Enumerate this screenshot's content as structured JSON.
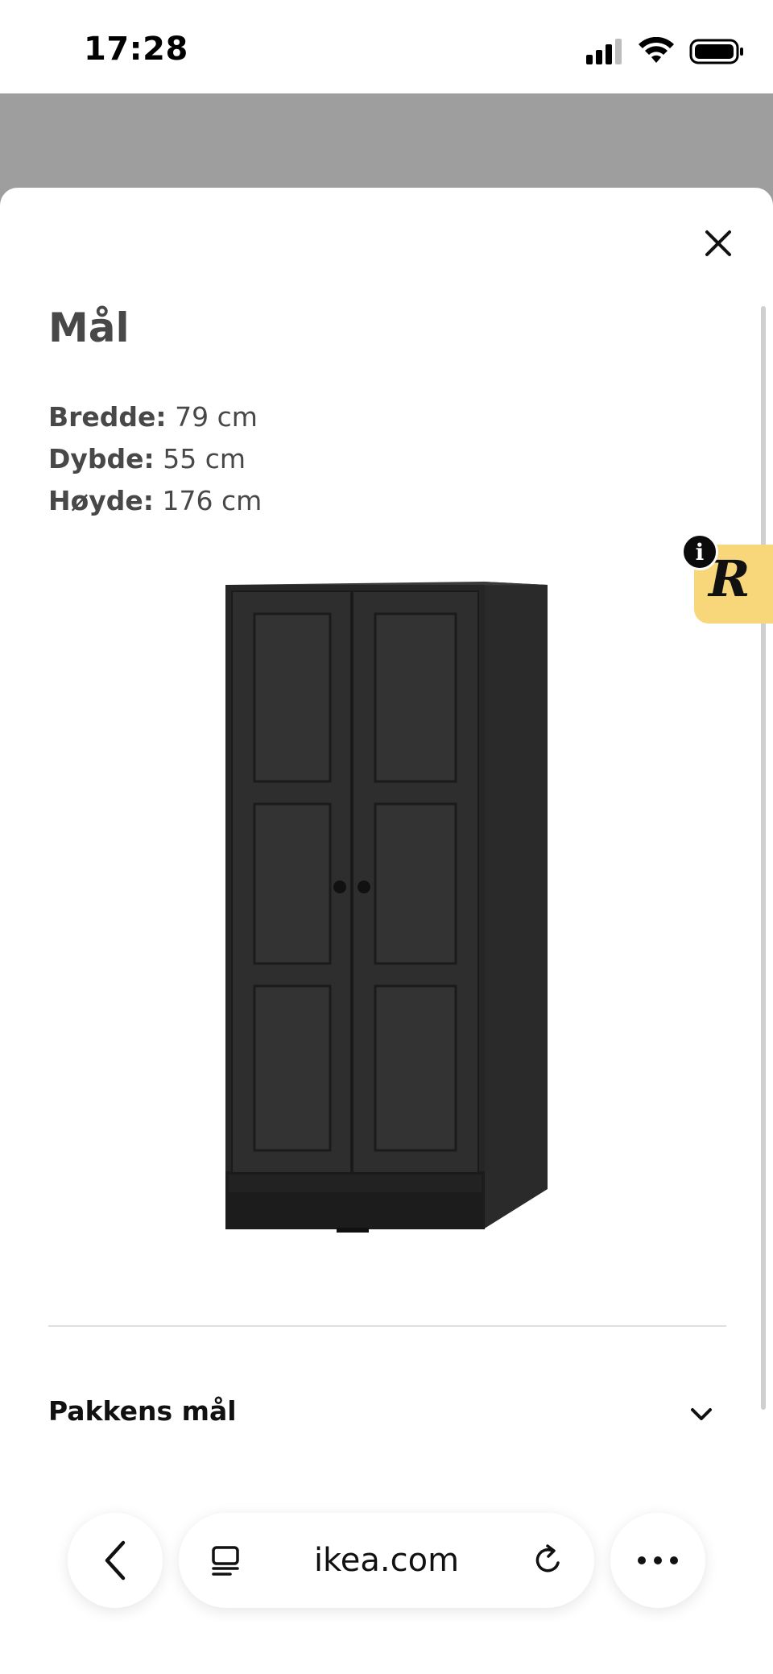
{
  "status_bar": {
    "time": "17:28"
  },
  "sheet": {
    "title": "Mål",
    "dimensions": [
      {
        "label": "Bredde:",
        "value": " 79 cm"
      },
      {
        "label": "Dybde:",
        "value": " 55 cm"
      },
      {
        "label": "Høyde:",
        "value": " 176 cm"
      }
    ],
    "accordion_label": "Pakkens mål"
  },
  "badge": {
    "info_glyph": "i",
    "letter": "R",
    "color": "#f8d77a"
  },
  "browser": {
    "url": "ikea.com"
  },
  "icons": [
    "signal-icon",
    "wifi-icon",
    "battery-icon",
    "close-icon",
    "chevron-down-icon",
    "chevron-left-icon",
    "reader-icon",
    "reload-icon",
    "more-icon",
    "info-icon"
  ]
}
